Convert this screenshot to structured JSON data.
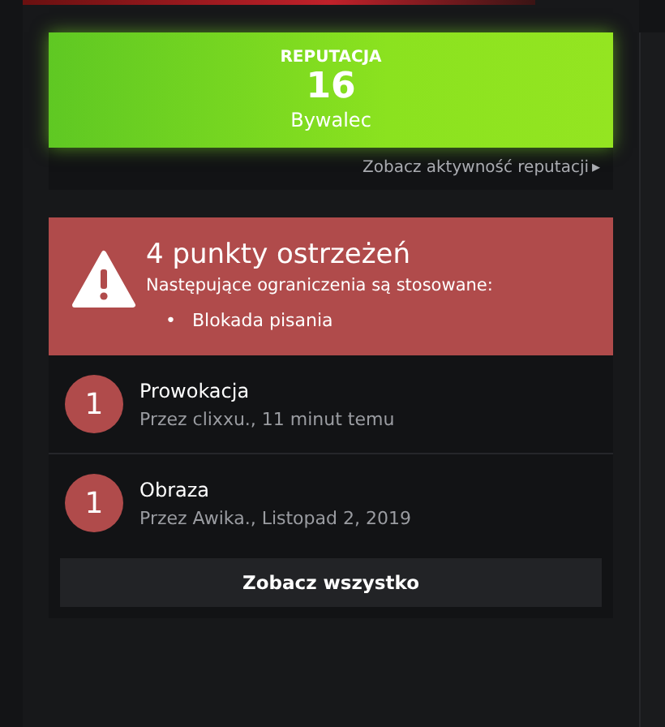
{
  "reputation": {
    "label": "REPUTACJA",
    "value": "16",
    "rank": "Bywalec",
    "link": "Zobacz aktywność reputacji",
    "link_icon": "▸"
  },
  "warnings": {
    "title": "4 punkty ostrzeżeń",
    "subtitle": "Następujące ograniczenia są stosowane:",
    "restrictions": [
      {
        "bullet": "•",
        "text": "Blokada pisania"
      }
    ],
    "items": [
      {
        "points": "1",
        "title": "Prowokacja",
        "meta": "Przez clixxu., 11 minut temu"
      },
      {
        "points": "1",
        "title": "Obraza",
        "meta": "Przez Awika., Listopad 2, 2019"
      }
    ],
    "button": "Zobacz wszystko"
  }
}
